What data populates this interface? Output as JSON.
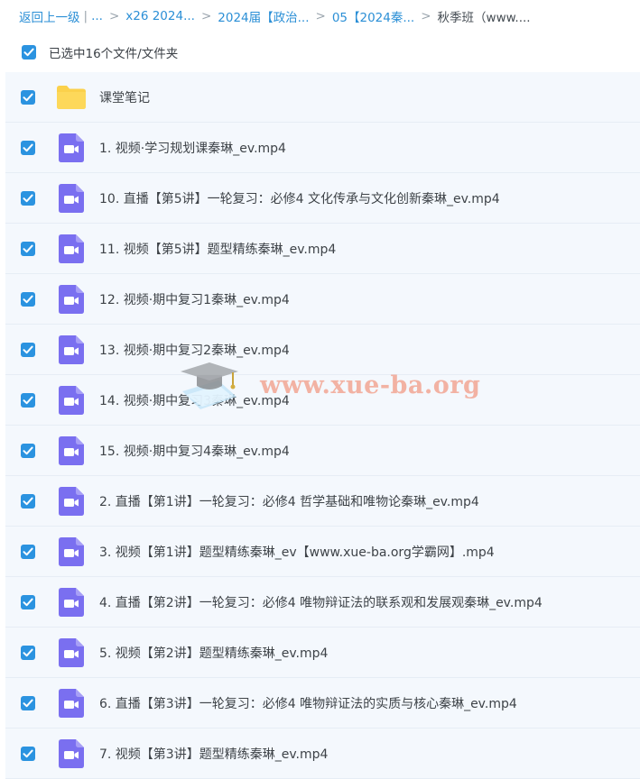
{
  "breadcrumb": {
    "back": "返回上一级",
    "sep_bar": "|",
    "ellipsis": "...",
    "sep": ">",
    "items": [
      "x26 2024...",
      "2024届【政治...",
      "05【2024秦..."
    ],
    "current": "秋季班（www...."
  },
  "selection": {
    "label": "已选中16个文件/文件夹"
  },
  "files": [
    {
      "type": "folder",
      "name": "课堂笔记"
    },
    {
      "type": "video",
      "name": "1. 视频·学习规划课秦琳_ev.mp4"
    },
    {
      "type": "video",
      "name": "10. 直播【第5讲】一轮复习：必修4 文化传承与文化创新秦琳_ev.mp4"
    },
    {
      "type": "video",
      "name": "11. 视频【第5讲】题型精练秦琳_ev.mp4"
    },
    {
      "type": "video",
      "name": "12. 视频·期中复习1秦琳_ev.mp4"
    },
    {
      "type": "video",
      "name": "13. 视频·期中复习2秦琳_ev.mp4"
    },
    {
      "type": "video",
      "name": "14. 视频·期中复习3秦琳_ev.mp4"
    },
    {
      "type": "video",
      "name": "15. 视频·期中复习4秦琳_ev.mp4"
    },
    {
      "type": "video",
      "name": "2. 直播【第1讲】一轮复习：必修4 哲学基础和唯物论秦琳_ev.mp4"
    },
    {
      "type": "video",
      "name": "3. 视频【第1讲】题型精练秦琳_ev【www.xue-ba.org学霸网】.mp4"
    },
    {
      "type": "video",
      "name": "4. 直播【第2讲】一轮复习：必修4 唯物辩证法的联系观和发展观秦琳_ev.mp4"
    },
    {
      "type": "video",
      "name": "5. 视频【第2讲】题型精练秦琳_ev.mp4"
    },
    {
      "type": "video",
      "name": "6. 直播【第3讲】一轮复习：必修4 唯物辩证法的实质与核心秦琳_ev.mp4"
    },
    {
      "type": "video",
      "name": "7. 视频【第3讲】题型精练秦琳_ev.mp4"
    }
  ],
  "watermark": {
    "text": "www.xue-ba.org"
  },
  "colors": {
    "link": "#2b8fd6",
    "checkbox": "#2b93e0",
    "row_bg": "#f4f8fd",
    "folder": "#fbd14b",
    "video": "#7a6ff0"
  }
}
